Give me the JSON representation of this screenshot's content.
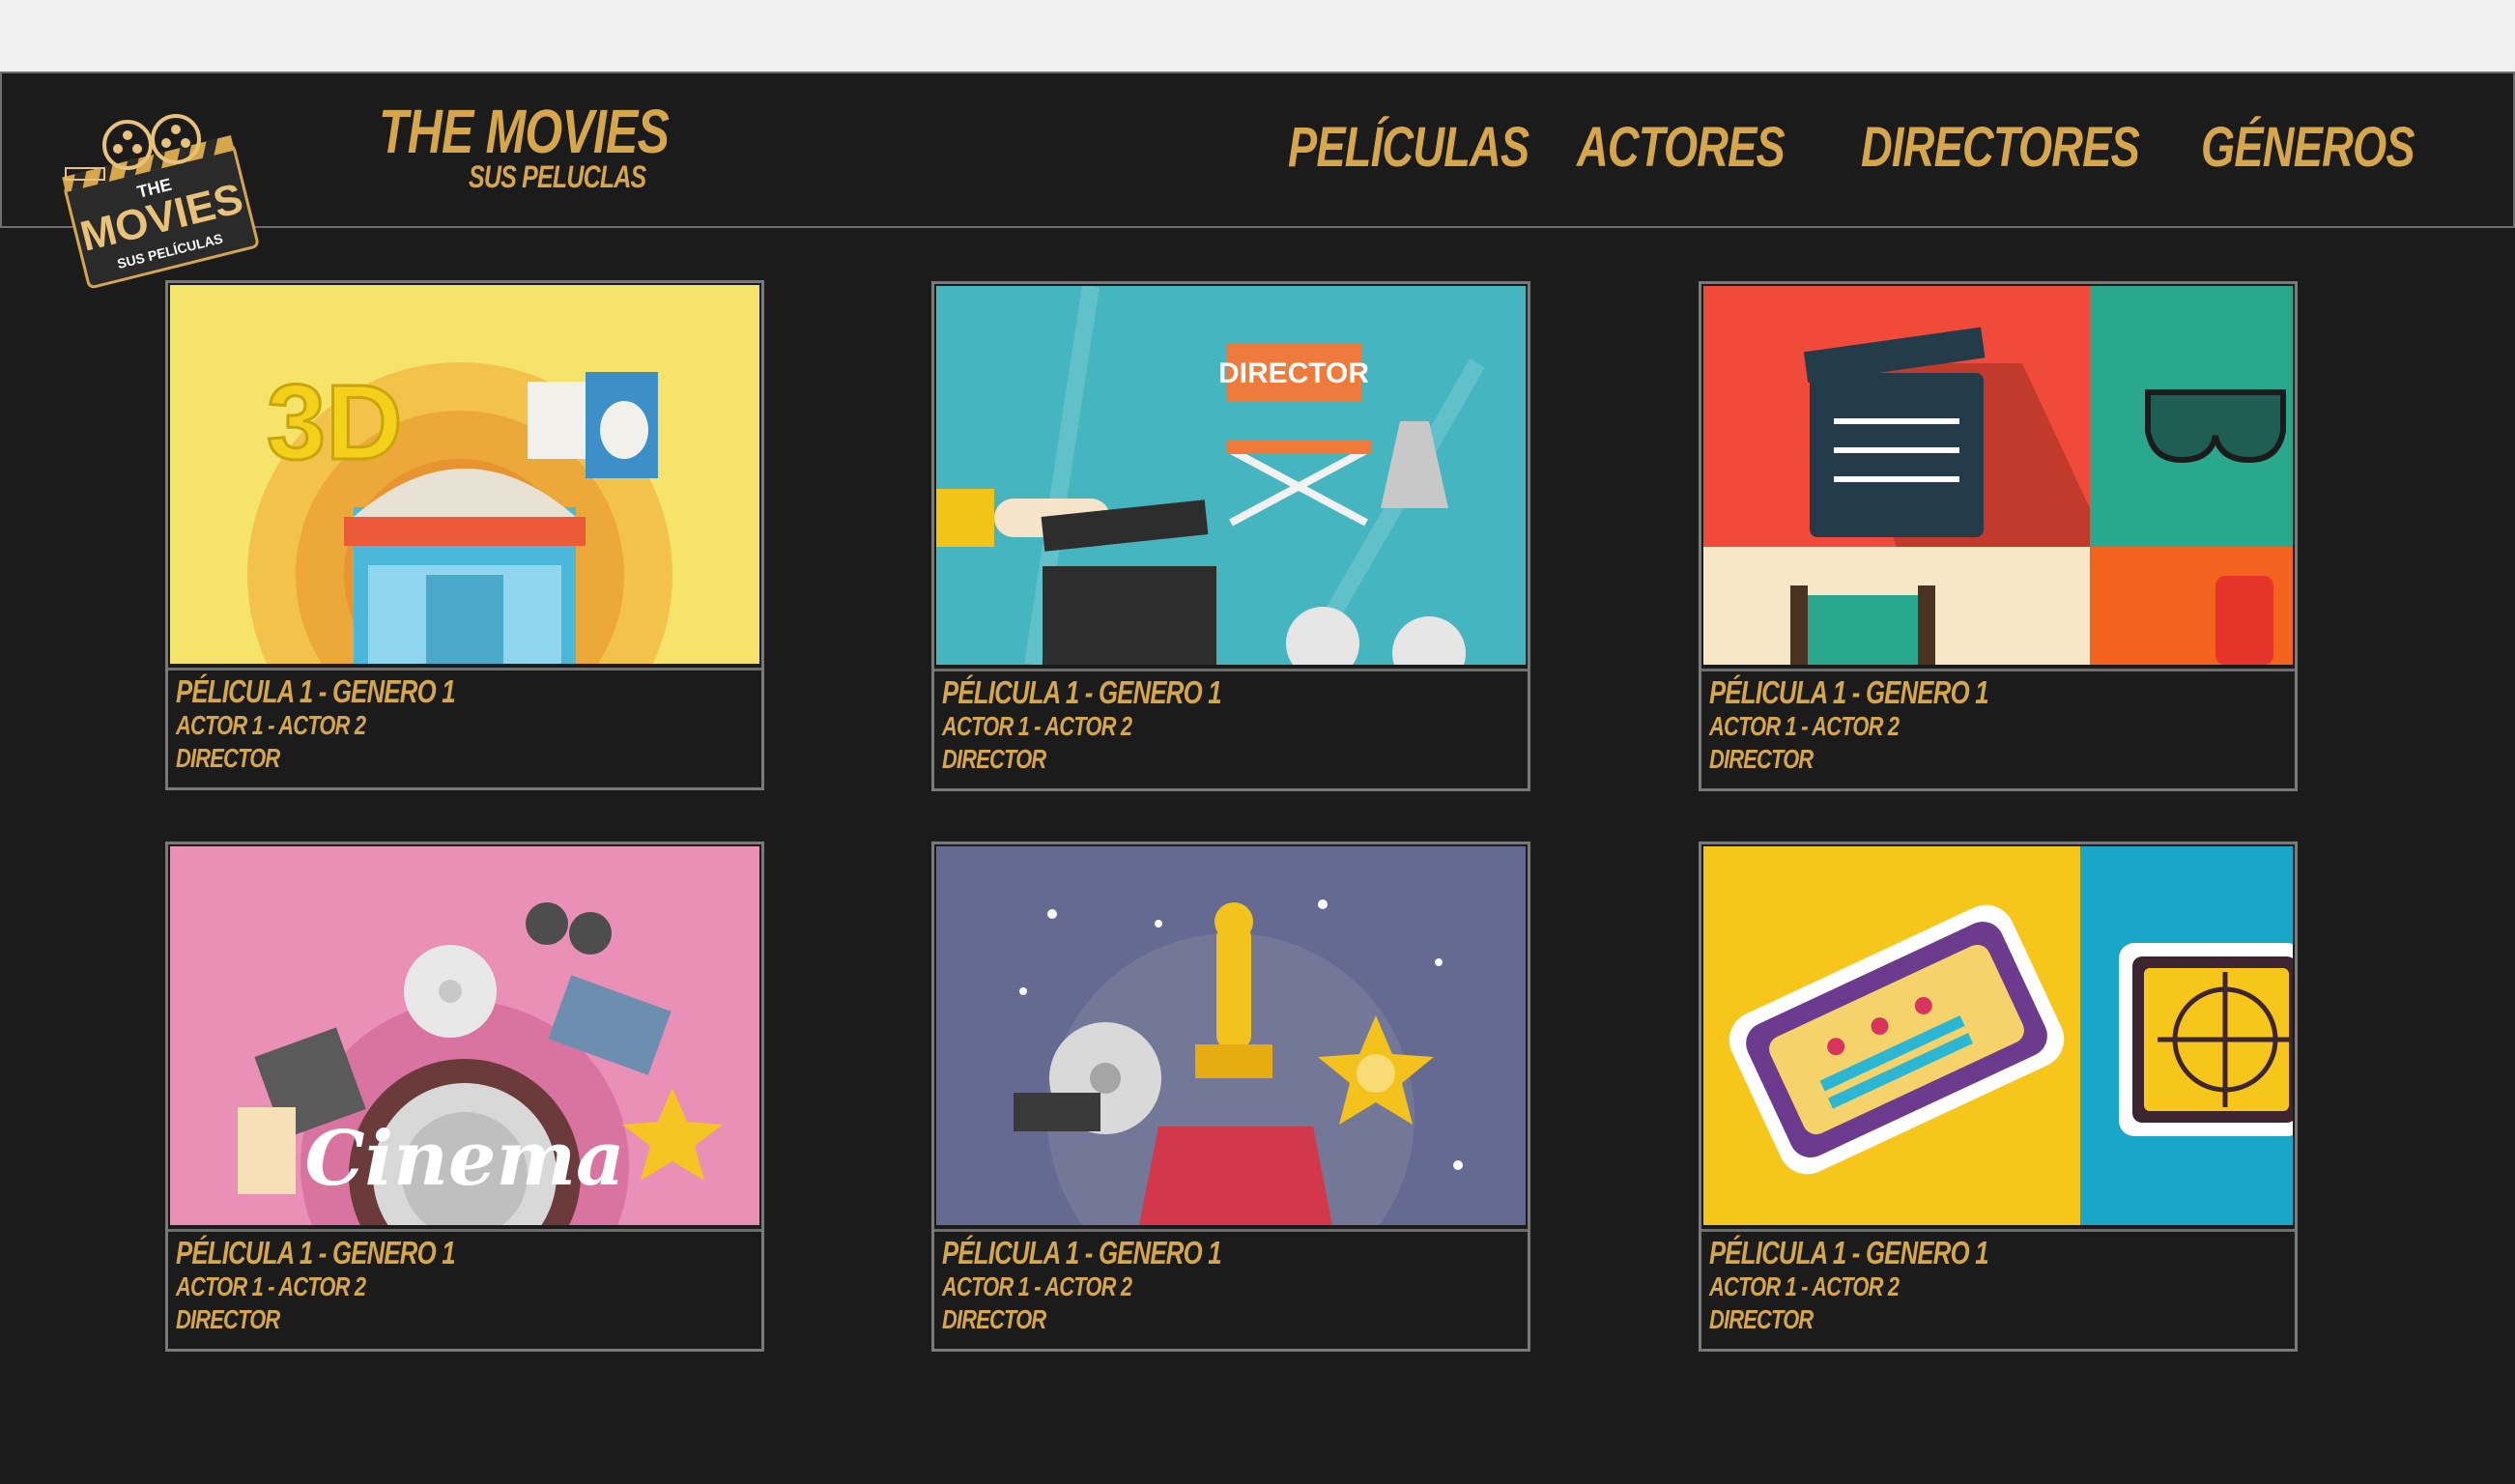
{
  "brand": {
    "title": "THE MOVIES",
    "subtitle": "SUS PELUCLAS",
    "logo_text_top": "THE",
    "logo_text_main": "MOVIES",
    "logo_text_bottom": "SUS PELÍCULAS"
  },
  "nav": {
    "items": [
      {
        "label": "PELÍCULAS"
      },
      {
        "label": "ACTORES"
      },
      {
        "label": "DIRECTORES"
      },
      {
        "label": "GÉNEROS"
      }
    ]
  },
  "cards": [
    {
      "title": "PÉLICULA 1 - GENERO 1",
      "actors": "ACTOR 1 - ACTOR 2",
      "director": "DIRECTOR",
      "image": "cinema-3d-illustration",
      "image_text": "3D"
    },
    {
      "title": "PÉLICULA 1 - GENERO 1",
      "actors": "ACTOR 1 - ACTOR 2",
      "director": "DIRECTOR",
      "image": "director-chair-illustration",
      "image_text": "DIRECTOR"
    },
    {
      "title": "PÉLICULA 1 - GENERO 1",
      "actors": "ACTOR 1 - ACTOR 2",
      "director": "DIRECTOR",
      "image": "clapperboard-tiles-illustration"
    },
    {
      "title": "PÉLICULA 1 - GENERO 1",
      "actors": "ACTOR 1 - ACTOR 2",
      "director": "DIRECTOR",
      "image": "cinema-pink-illustration",
      "image_text": "Cinema"
    },
    {
      "title": "PÉLICULA 1 - GENERO 1",
      "actors": "ACTOR 1 - ACTOR 2",
      "director": "DIRECTOR",
      "image": "award-statue-illustration"
    },
    {
      "title": "PÉLICULA 1 - GENERO 1",
      "actors": "ACTOR 1 - ACTOR 2",
      "director": "DIRECTOR",
      "image": "ticket-tiles-illustration"
    }
  ],
  "colors": {
    "background": "#1b1b1b",
    "accent_gold": "#d6a64a",
    "border_gray": "#7a7a7a"
  }
}
